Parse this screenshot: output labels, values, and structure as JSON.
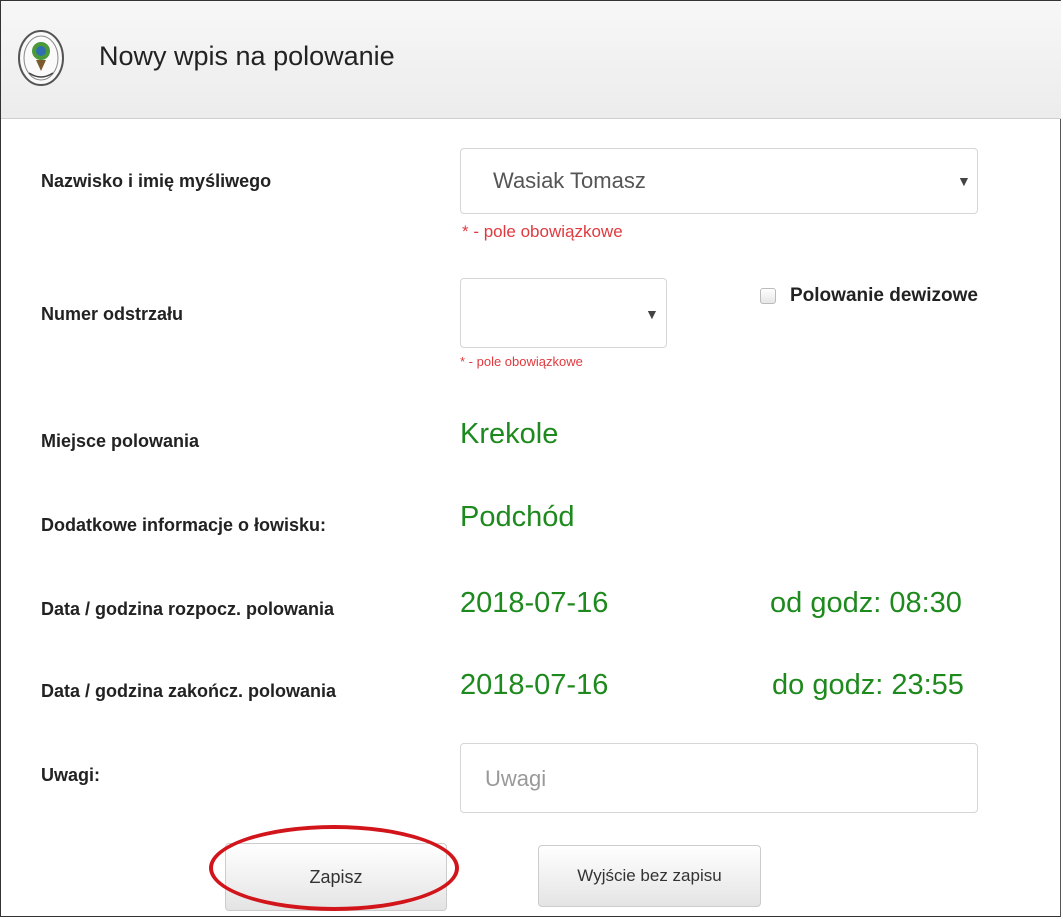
{
  "header": {
    "title": "Nowy wpis na polowanie"
  },
  "form": {
    "hunter": {
      "label": "Nazwisko i imię myśliwego",
      "value": "Wasiak Tomasz",
      "required_note": "* - pole obowiązkowe"
    },
    "permit": {
      "label": "Numer odstrzału",
      "value": "",
      "required_note": "* - pole obowiązkowe"
    },
    "foreign_hunt": {
      "label": "Polowanie dewizowe",
      "checked": false
    },
    "place": {
      "label": "Miejsce polowania",
      "value": "Krekole"
    },
    "area_info": {
      "label": "Dodatkowe informacje o łowisku:",
      "value": "Podchód"
    },
    "start": {
      "label": "Data / godzina rozpocz. polowania",
      "date": "2018-07-16",
      "time": "od godz: 08:30"
    },
    "end": {
      "label": "Data / godzina zakończ. polowania",
      "date": "2018-07-16",
      "time": "do godz: 23:55"
    },
    "notes": {
      "label": "Uwagi:",
      "placeholder": "Uwagi",
      "value": ""
    }
  },
  "actions": {
    "save_label": "Zapisz",
    "exit_label": "Wyjście bez zapisu"
  },
  "colors": {
    "accent_green": "#1e8a1e",
    "required_red": "#e0393e",
    "highlight_oval": "#d2141b"
  }
}
